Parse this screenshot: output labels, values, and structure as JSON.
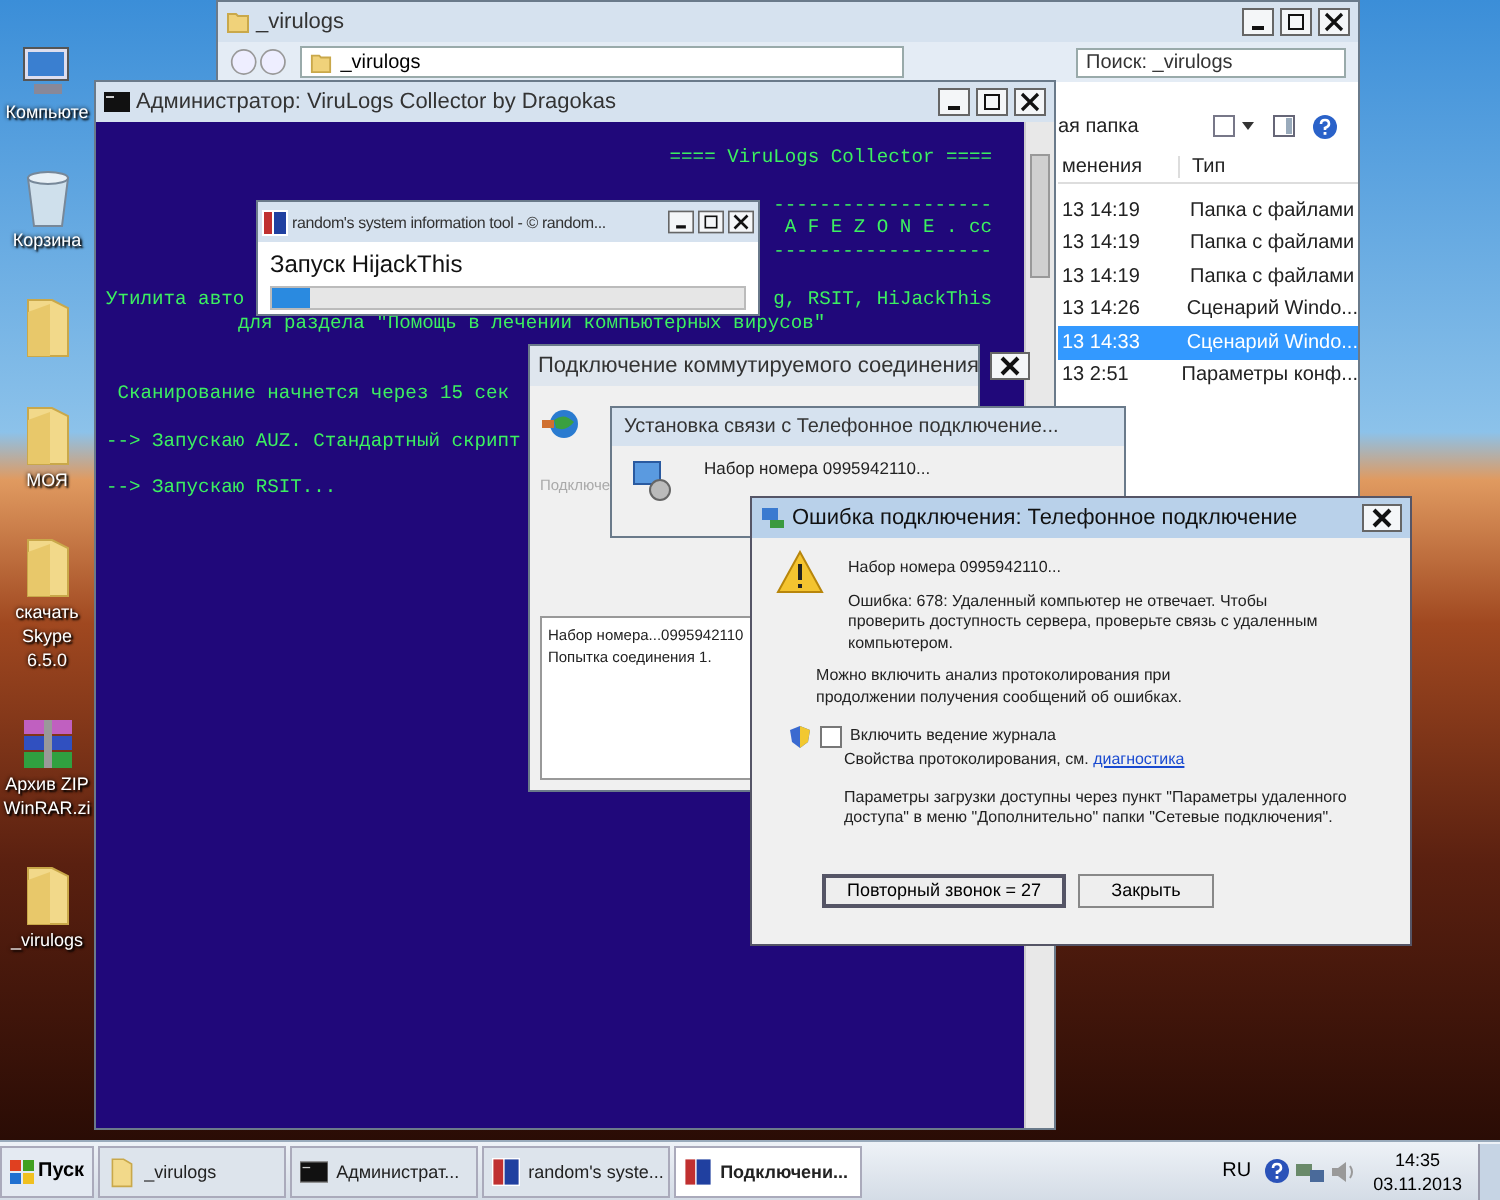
{
  "desktop_icons": [
    {
      "kind": "computer",
      "label": "Компьюте"
    },
    {
      "kind": "trash",
      "label": "Корзина"
    },
    {
      "kind": "folder"
    },
    {
      "kind": "folder",
      "label": "МОЯ"
    },
    {
      "kind": "folder",
      "label": "скачать Skype 6.5.0"
    },
    {
      "kind": "archive",
      "label": "Архив ZIP WinRAR.zi"
    },
    {
      "kind": "folder",
      "label": "_virulogs"
    }
  ],
  "explorer": {
    "title": "_virulogs",
    "address": "_virulogs",
    "search": {
      "placeholder": "Поиск: _virulogs"
    },
    "toolbar_item": "ая папка",
    "columns": [
      "менения",
      "Тип"
    ],
    "rows": [
      {
        "date": "13 14:19",
        "type": "Папка с файлами",
        "selected": false
      },
      {
        "date": "13 14:19",
        "type": "Папка с файлами",
        "selected": false
      },
      {
        "date": "13 14:19",
        "type": "Папка с файлами",
        "selected": false
      },
      {
        "date": "13 14:26",
        "type": "Сценарий Windo...",
        "selected": false
      },
      {
        "date": "13 14:33",
        "type": "Сценарий Windo...",
        "selected": true
      },
      {
        "date": "13 2:51",
        "type": "Параметры конф...",
        "selected": false
      }
    ]
  },
  "console": {
    "title": "Администратор:  ViruLogs Collector by Dragokas",
    "lines": [
      {
        "kind": "banner",
        "parts": [
          "==== ViruLogs Collector ===="
        ]
      },
      {
        "kind": "blank"
      },
      {
        "kind": "banner",
        "parts": [
          "-------------------"
        ]
      },
      {
        "kind": "banner",
        "parts": [
          "A F E Z O N E . cc"
        ]
      },
      {
        "kind": "banner",
        "parts": [
          "-------------------"
        ]
      },
      {
        "kind": "blank"
      },
      {
        "kind": "split",
        "parts": [
          "Утилита авто",
          "g, RSIT, HiJackThis"
        ]
      },
      {
        "kind": "indented",
        "parts": [
          "для раздела \"Помощь в лечении компьютерных вирусов\""
        ]
      },
      {
        "kind": "blank"
      },
      {
        "kind": "blank"
      },
      {
        "kind": "plain",
        "parts": [
          " Сканирование начнется через 15 сек"
        ]
      },
      {
        "kind": "blank"
      },
      {
        "kind": "plain",
        "parts": [
          "--> Запускаю AUZ. Стандартный скрипт"
        ]
      },
      {
        "kind": "blank"
      },
      {
        "kind": "plain",
        "parts": [
          "--> Запускаю RSIT..."
        ]
      }
    ]
  },
  "rsit": {
    "title": "random's system information tool - © random...",
    "status": "Запуск HijackThis",
    "level": 0.08
  },
  "dialup": {
    "title": "Подключение коммутируемого соединения",
    "label": "Подключе",
    "log": [
      "Набор номера...0995942110",
      "Попытка соединения 1."
    ]
  },
  "connecting": {
    "title": "Установка связи с Телефонное подключение...",
    "message": "Набор номера 0995942110..."
  },
  "error_dialog": {
    "title": "Ошибка подключения: Телефонное подключение",
    "dialing": "Набор номера 0995942110...",
    "error": "Ошибка: 678: Удаленный компьютер не отвечает. Чтобы проверить доступность сервера, проверьте связь с удаленным компьютером.",
    "logging_hint": "Можно включить анализ протоколирования при продолжении получения сообщений об ошибках.",
    "checkbox": {
      "label": "Включить ведение журнала",
      "checked": false
    },
    "properties_text": "Свойства протоколирования, см.",
    "properties_link": "диагностика",
    "params": "Параметры загрузки доступны через пункт \"Параметры удаленного доступа\" в меню \"Дополнительно\" папки \"Сетевые подключения\".",
    "buttons": [
      "Повторный звонок = 27",
      "Закрыть"
    ]
  },
  "taskbar": {
    "start": "Пуск",
    "tasks": [
      {
        "kind": "folder",
        "label": "_virulogs",
        "selected": false
      },
      {
        "kind": "console",
        "label": "Администрат...",
        "selected": false
      },
      {
        "kind": "app",
        "label": "random's syste...",
        "selected": false
      },
      {
        "kind": "app",
        "label": "Подключени...",
        "selected": true
      }
    ],
    "language": "RU",
    "time": "14:35",
    "date": "03.11.2013"
  }
}
